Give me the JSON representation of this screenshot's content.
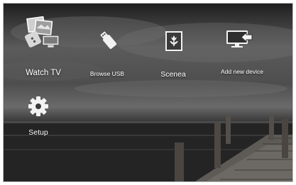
{
  "menu": {
    "items": [
      {
        "label": "Watch TV",
        "icon": "tv-photo-icon"
      },
      {
        "label": "Browse USB",
        "icon": "usb-icon"
      },
      {
        "label": "Scenea",
        "icon": "scenea-flower-icon"
      },
      {
        "label": "Add new device",
        "icon": "add-device-icon"
      },
      {
        "label": "Setup",
        "icon": "gear-icon"
      }
    ]
  },
  "colors": {
    "label": "#ffffff",
    "icon_fill": "#f2f2f2"
  }
}
